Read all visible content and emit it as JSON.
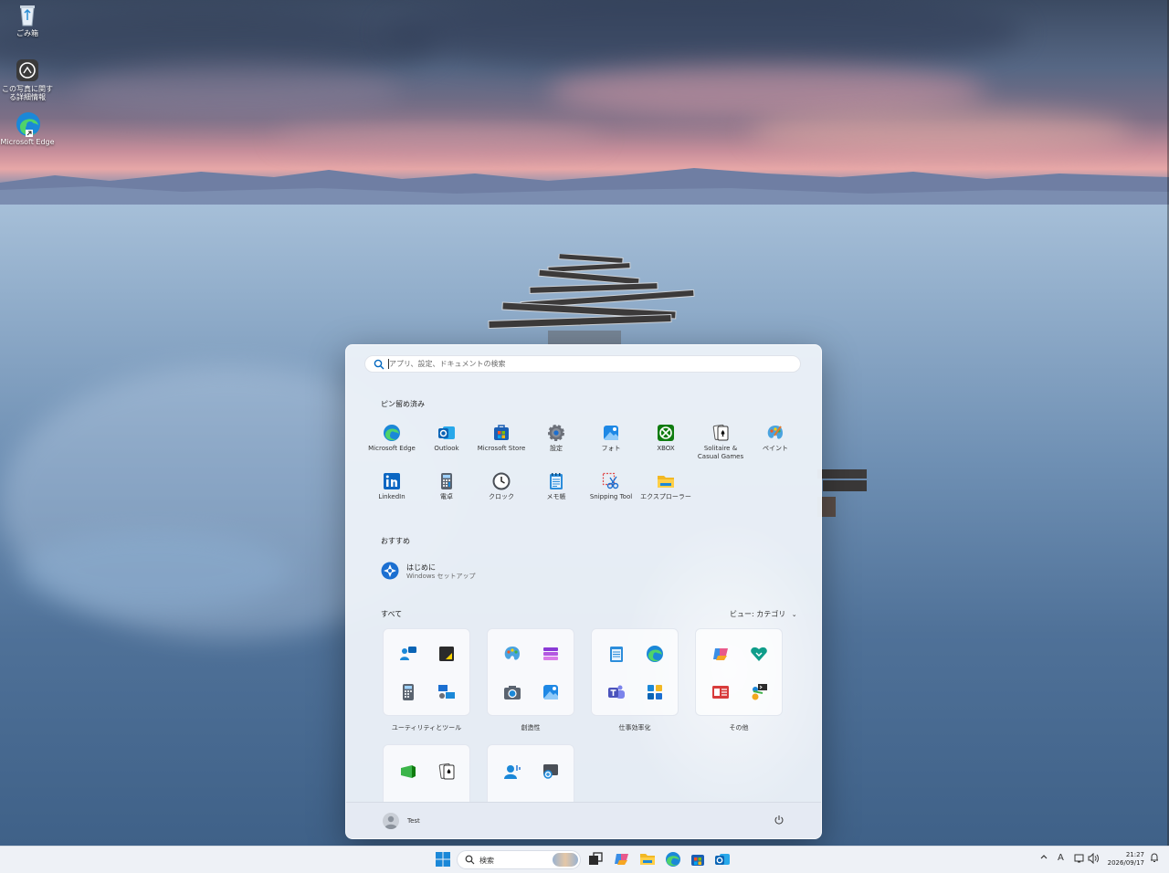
{
  "desktop": {
    "icons": [
      {
        "name": "recycle-bin",
        "label": "ごみ箱"
      },
      {
        "name": "photo-details",
        "label": "この写真に関する詳細情報"
      },
      {
        "name": "microsoft-edge",
        "label": "Microsoft Edge"
      }
    ]
  },
  "start_menu": {
    "search_placeholder": "アプリ、設定、ドキュメントの検索",
    "pinned_title": "ピン留め済み",
    "pinned": [
      {
        "label": "Microsoft Edge",
        "icon": "edge-icon"
      },
      {
        "label": "Outlook",
        "icon": "outlook-icon"
      },
      {
        "label": "Microsoft Store",
        "icon": "store-icon"
      },
      {
        "label": "設定",
        "icon": "settings-icon"
      },
      {
        "label": "フォト",
        "icon": "photos-icon"
      },
      {
        "label": "XBOX",
        "icon": "xbox-icon"
      },
      {
        "label": "Solitaire & Casual Games",
        "icon": "solitaire-icon"
      },
      {
        "label": "ペイント",
        "icon": "paint-icon"
      },
      {
        "label": "LinkedIn",
        "icon": "linkedin-icon"
      },
      {
        "label": "電卓",
        "icon": "calculator-icon"
      },
      {
        "label": "クロック",
        "icon": "clock-icon"
      },
      {
        "label": "メモ帳",
        "icon": "notepad-icon"
      },
      {
        "label": "Snipping Tool",
        "icon": "snipping-tool-icon"
      },
      {
        "label": "エクスプローラー",
        "icon": "file-explorer-icon"
      }
    ],
    "recommended_title": "おすすめ",
    "recommended": [
      {
        "title": "はじめに",
        "subtitle": "Windows セットアップ",
        "icon": "get-started-icon"
      }
    ],
    "all_title": "すべて",
    "view_toggle": "ビュー: カテゴリ",
    "categories": [
      {
        "label": "ユーティリティとツール"
      },
      {
        "label": "創造性"
      },
      {
        "label": "仕事効率化"
      },
      {
        "label": "その他"
      }
    ],
    "user_name": "Test"
  },
  "taskbar": {
    "search_label": "検索",
    "ime_indicator": "A",
    "time": "21:27",
    "date": "2026/09/17"
  },
  "colors": {
    "accent": "#0067c0",
    "edge_blue": "#1b88d8",
    "xbox_green": "#107c10",
    "start_bg": "#ecf1f8"
  }
}
